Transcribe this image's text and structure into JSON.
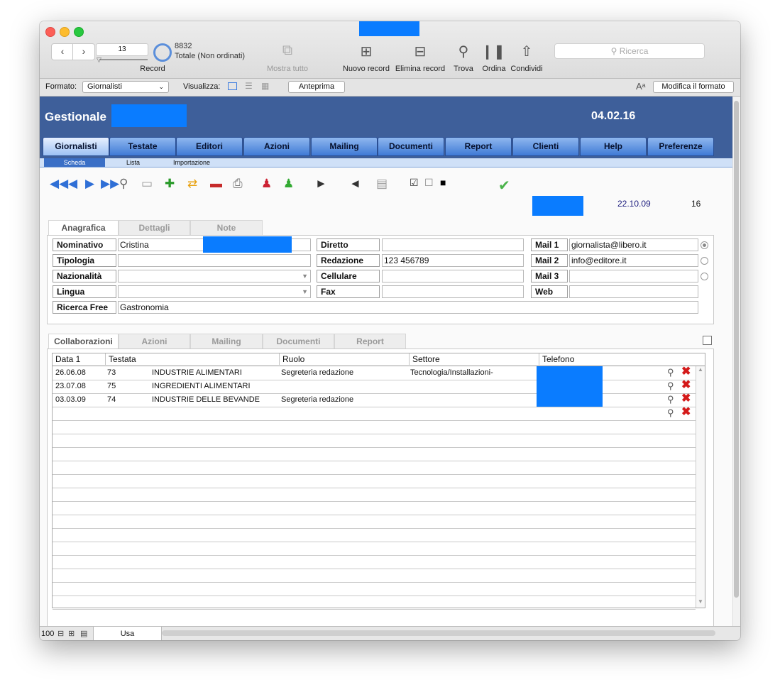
{
  "window": {
    "title_redacted": true
  },
  "toolbar": {
    "record_number": "13",
    "record_label": "Record",
    "total_count": "8832",
    "total_label": "Totale (Non ordinati)",
    "show_all": "Mostra tutto",
    "new_record": "Nuovo record",
    "delete_record": "Elimina record",
    "find": "Trova",
    "sort": "Ordina",
    "share": "Condividi",
    "search_placeholder": "Ricerca"
  },
  "formatbar": {
    "format_label": "Formato:",
    "format_value": "Giornalisti",
    "view_label": "Visualizza:",
    "preview": "Anteprima",
    "edit_format": "Modifica il formato"
  },
  "header": {
    "title": "Gestionale",
    "date": "04.02.16"
  },
  "tabs": [
    "Giornalisti",
    "Testate",
    "Editori",
    "Azioni",
    "Mailing",
    "Documenti",
    "Report",
    "Clienti",
    "Help",
    "Preferenze"
  ],
  "subtabs": [
    "Scheda",
    "Lista",
    "Importazione"
  ],
  "record_info": {
    "date": "22.10.09",
    "count": "16"
  },
  "form_tabs": [
    "Anagrafica",
    "Dettagli",
    "Note"
  ],
  "form": {
    "nominativo_label": "Nominativo",
    "nominativo_value": "Cristina",
    "tipologia_label": "Tipologia",
    "tipologia_value": "",
    "nazionalita_label": "Nazionalità",
    "nazionalita_value": "",
    "lingua_label": "Lingua",
    "lingua_value": "",
    "ricerca_label": "Ricerca Free",
    "ricerca_value": "Gastronomia",
    "diretto_label": "Diretto",
    "diretto_value": "",
    "redazione_label": "Redazione",
    "redazione_value": "123 456789",
    "cellulare_label": "Cellulare",
    "cellulare_value": "",
    "fax_label": "Fax",
    "fax_value": "",
    "mail1_label": "Mail 1",
    "mail1_value": "giornalista@libero.it",
    "mail2_label": "Mail 2",
    "mail2_value": "info@editore.it",
    "mail3_label": "Mail 3",
    "mail3_value": "",
    "web_label": "Web",
    "web_value": ""
  },
  "lower_tabs": [
    "Collaborazioni",
    "Azioni",
    "Mailing",
    "Documenti",
    "Report"
  ],
  "grid": {
    "headers": [
      "Data 1",
      "Testata",
      "Ruolo",
      "Settore",
      "Telefono"
    ],
    "rows": [
      {
        "date": "26.06.08",
        "code": "73",
        "name": "INDUSTRIE ALIMENTARI",
        "role": "Segreteria redazione",
        "sector": "Tecnologia/Installazioni-"
      },
      {
        "date": "23.07.08",
        "code": "75",
        "name": "INGREDIENTI ALIMENTARI",
        "role": "",
        "sector": ""
      },
      {
        "date": "03.03.09",
        "code": "74",
        "name": "INDUSTRIE DELLE BEVANDE",
        "role": "Segreteria redazione",
        "sector": ""
      }
    ]
  },
  "statusbar": {
    "zoom": "100",
    "mode": "Usa"
  }
}
